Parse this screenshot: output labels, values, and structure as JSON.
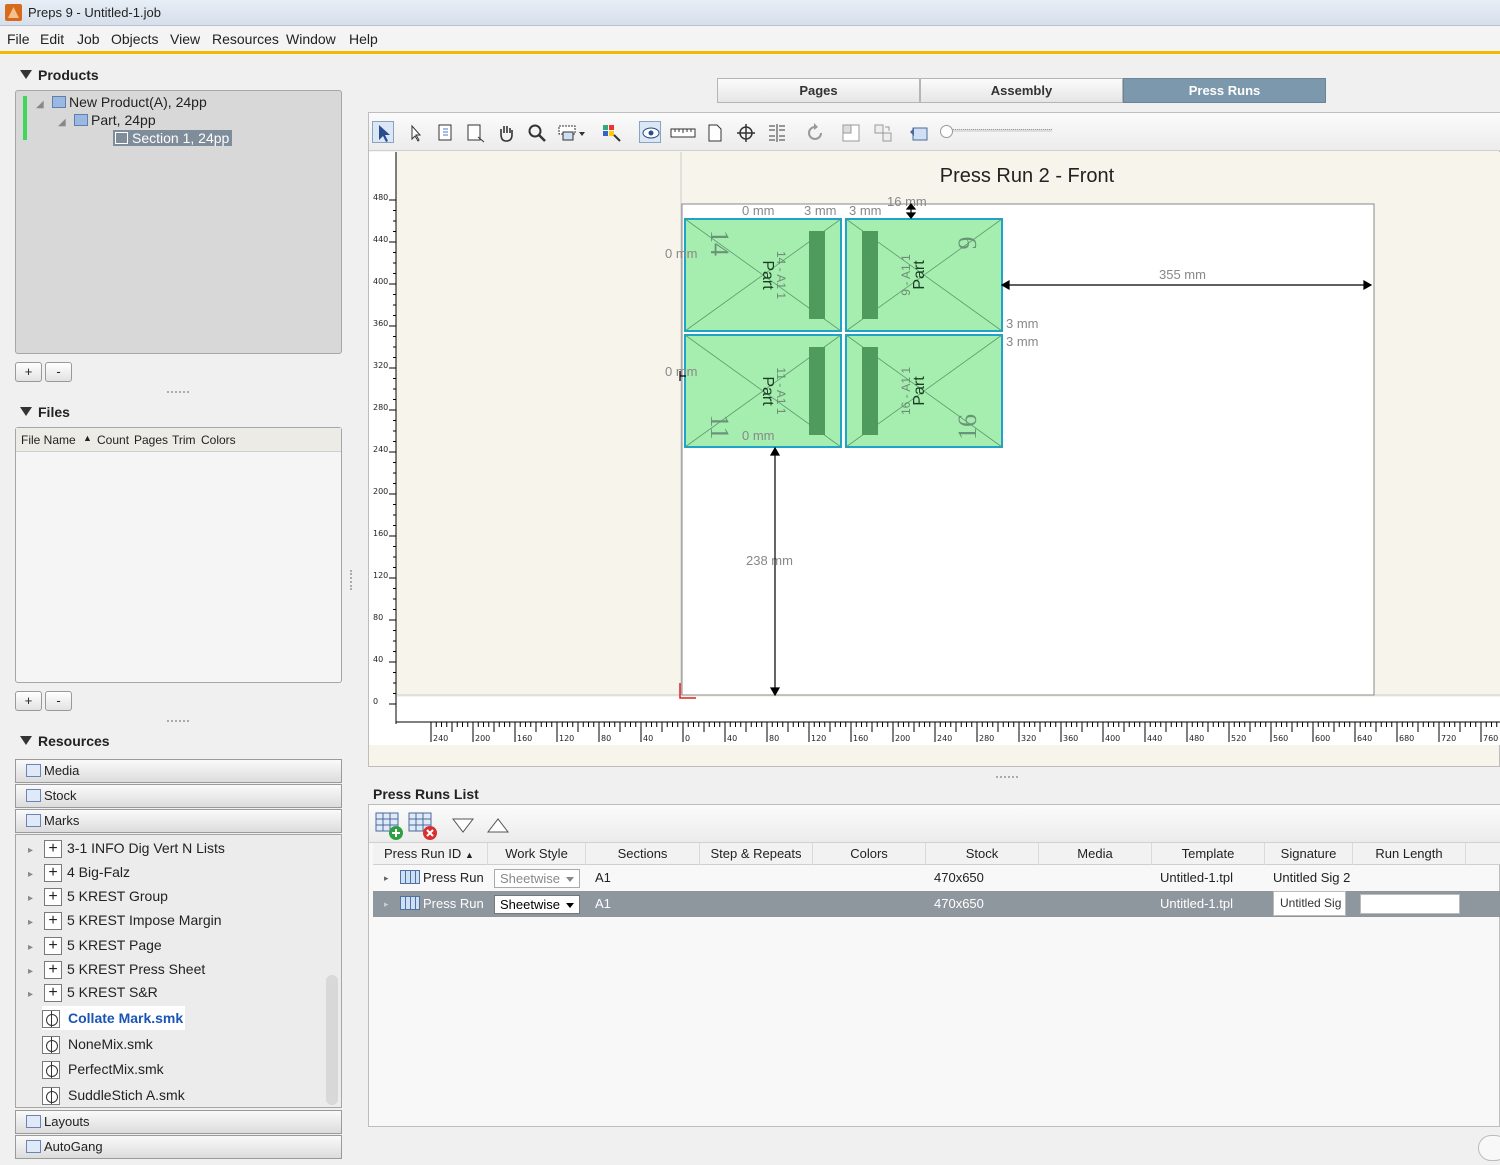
{
  "window": {
    "title": "Preps 9 - Untitled-1.job"
  },
  "menu": [
    "File",
    "Edit",
    "Job",
    "Objects",
    "View",
    "Resources",
    "Window",
    "Help"
  ],
  "products": {
    "heading": "Products",
    "tree": [
      "New Product(A), 24pp",
      "Part, 24pp",
      "Section 1, 24pp"
    ],
    "add_label": "+",
    "remove_label": "-"
  },
  "files": {
    "heading": "Files",
    "columns": [
      "File Name",
      "Count",
      "Pages",
      "Trim",
      "Colors"
    ],
    "add_label": "+",
    "remove_label": "-"
  },
  "resources": {
    "heading": "Resources",
    "groups": [
      "Media",
      "Stock",
      "Marks",
      "Layouts",
      "AutoGang"
    ],
    "mark_folders": [
      "3-1 INFO Dig Vert N Lists",
      "4 Big-Falz",
      "5 KREST Group",
      "5 KREST Impose Margin",
      "5 KREST Page",
      "5 KREST Press Sheet",
      "5 KREST S&R"
    ],
    "mark_files": [
      "Collate Mark.smk",
      "NoneMix.smk",
      "PerfectMix.smk",
      "SuddleStich A.smk"
    ]
  },
  "tabs": [
    "Pages",
    "Assembly",
    "Press Runs"
  ],
  "active_tab": "Press Runs",
  "canvas": {
    "title": "Press Run 2 - Front",
    "y_ticks": [
      "480",
      "440",
      "400",
      "360",
      "320",
      "280",
      "240",
      "200",
      "160",
      "120",
      "80",
      "40",
      "0"
    ],
    "x_ticks": [
      "240",
      "200",
      "160",
      "120",
      "80",
      "40",
      "0",
      "40",
      "80",
      "120",
      "160",
      "200",
      "240",
      "280",
      "320",
      "360",
      "400",
      "440",
      "480",
      "520",
      "560",
      "600",
      "640",
      "680",
      "720",
      "760"
    ],
    "dims": {
      "top_left": "0 mm",
      "gap_a": "3 mm",
      "gap_b": "3 mm",
      "top": "16 mm",
      "left": "0 mm",
      "right": "355 mm",
      "vgap_a": "3 mm",
      "vgap_b": "3 mm",
      "left_mid": "0 mm",
      "bottom_inner": "0 mm",
      "bottom": "238 mm"
    },
    "pages": [
      {
        "number": "14",
        "label": "Part",
        "folio": "14 - A1 1"
      },
      {
        "number": "9",
        "label": "Part",
        "folio": "9 - A1 1"
      },
      {
        "number": "11",
        "label": "Part",
        "folio": "11 - A1 1"
      },
      {
        "number": "16",
        "label": "Part",
        "folio": "16 - A1 1"
      }
    ],
    "colors": {
      "page_fill": "#a6eeb0",
      "page_border": "#1fa3c8",
      "spine": "#4f9a5d"
    }
  },
  "press_runs_list": {
    "title": "Press Runs List",
    "columns": [
      "Press Run ID",
      "Work Style",
      "Sections",
      "Step & Repeats",
      "Colors",
      "Stock",
      "Media",
      "Template",
      "Signature",
      "Run Length"
    ],
    "rows": [
      {
        "id": "Press Run",
        "work_style": "Sheetwise",
        "sections": "A1",
        "stock": "470x650",
        "template": "Untitled-1.tpl",
        "signature": "Untitled Sig 2"
      },
      {
        "id": "Press Run",
        "work_style": "Sheetwise",
        "sections": "A1",
        "stock": "470x650",
        "template": "Untitled-1.tpl",
        "signature": "Untitled Sig"
      }
    ]
  }
}
